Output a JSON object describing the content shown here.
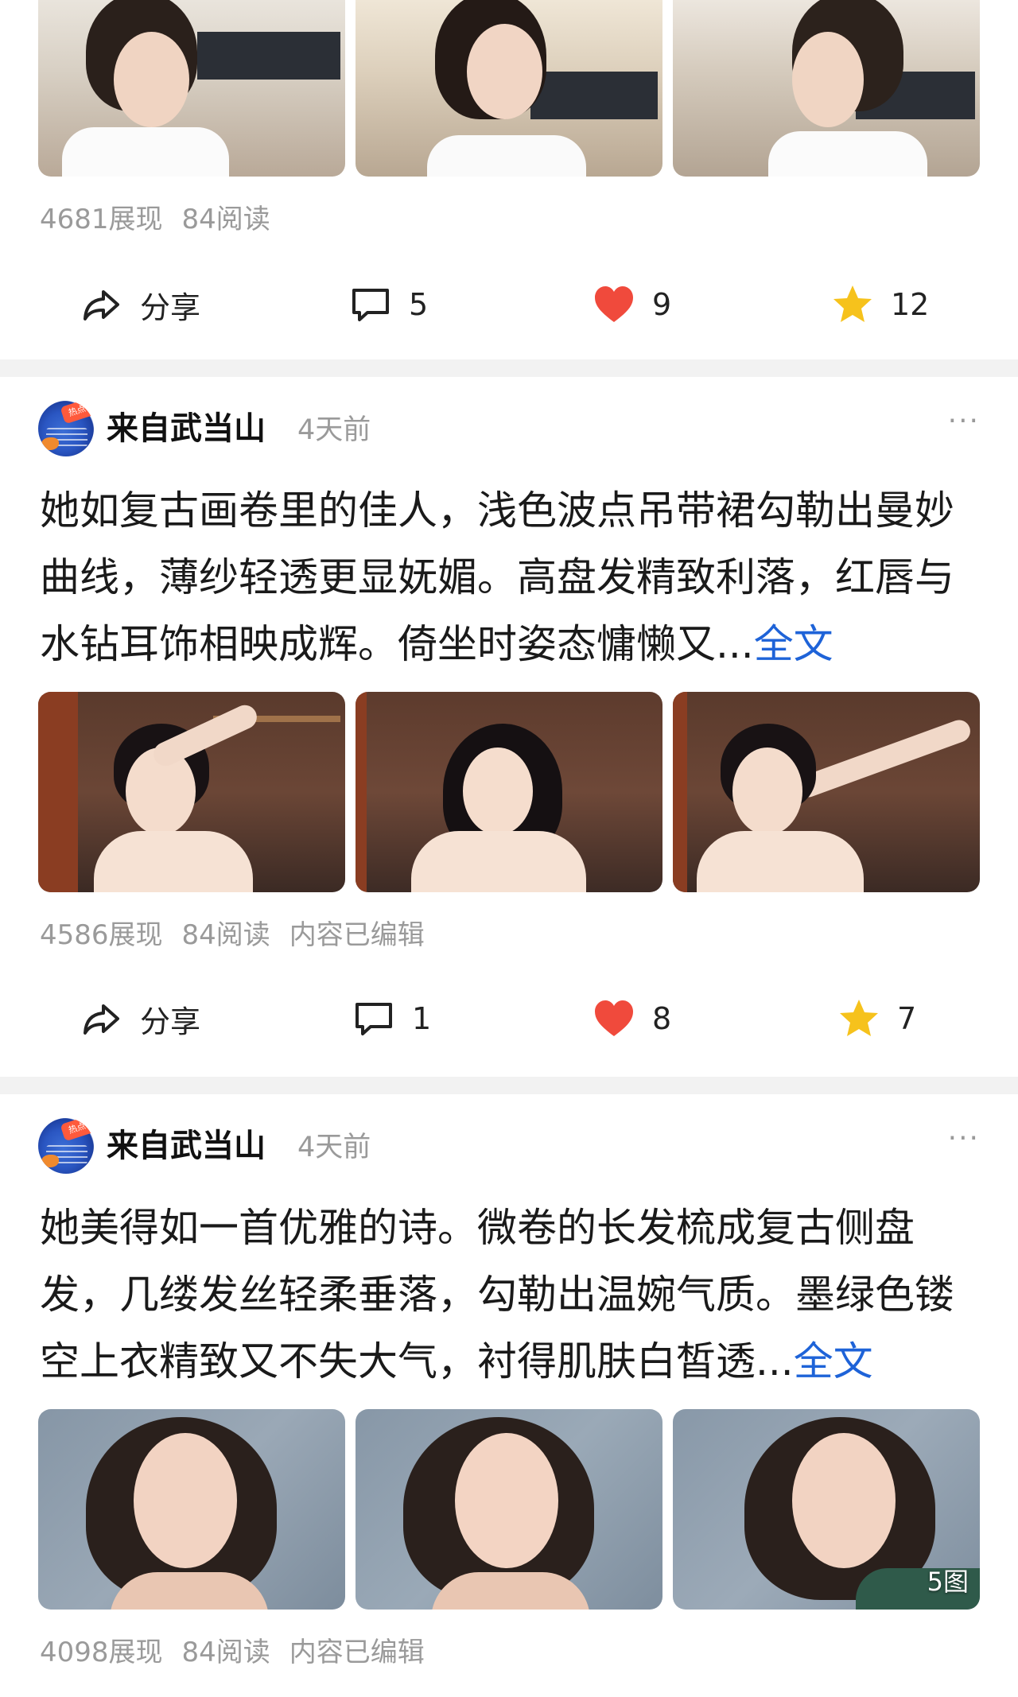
{
  "post1": {
    "stats": {
      "views": "4681展现",
      "reads": "84阅读"
    },
    "actions": {
      "share": "分享",
      "comments": "5",
      "likes": "9",
      "favorites": "12"
    }
  },
  "post2": {
    "author": "来自武当山",
    "time": "4天前",
    "more": "···",
    "text": "她如复古画卷里的佳人，浅色波点吊带裙勾勒出曼妙曲线，薄纱轻透更显妩媚。高盘发精致利落，红唇与水钻耳饰相映成辉。倚坐时姿态慵懒又...",
    "fulltext": "全文",
    "stats": {
      "views": "4586展现",
      "reads": "84阅读",
      "edited": "内容已编辑"
    },
    "actions": {
      "share": "分享",
      "comments": "1",
      "likes": "8",
      "favorites": "7"
    }
  },
  "post3": {
    "author": "来自武当山",
    "time": "4天前",
    "more": "···",
    "text": "她美得如一首优雅的诗。微卷的长发梳成复古侧盘发，几缕发丝轻柔垂落，勾勒出温婉气质。墨绿色镂空上衣精致又不失大气，衬得肌肤白皙透...",
    "fulltext": "全文",
    "image_count": "5图",
    "stats": {
      "views": "4098展现",
      "reads": "84阅读",
      "edited": "内容已编辑"
    }
  },
  "colors": {
    "link": "#1e63d8",
    "like": "#f04a3c",
    "favorite": "#f6c21c",
    "divider": "#f2f2f2"
  },
  "icons": {
    "share": "share-arrow-icon",
    "comment": "comment-bubble-icon",
    "like": "heart-icon",
    "favorite": "star-icon",
    "more": "more-dots-icon"
  }
}
